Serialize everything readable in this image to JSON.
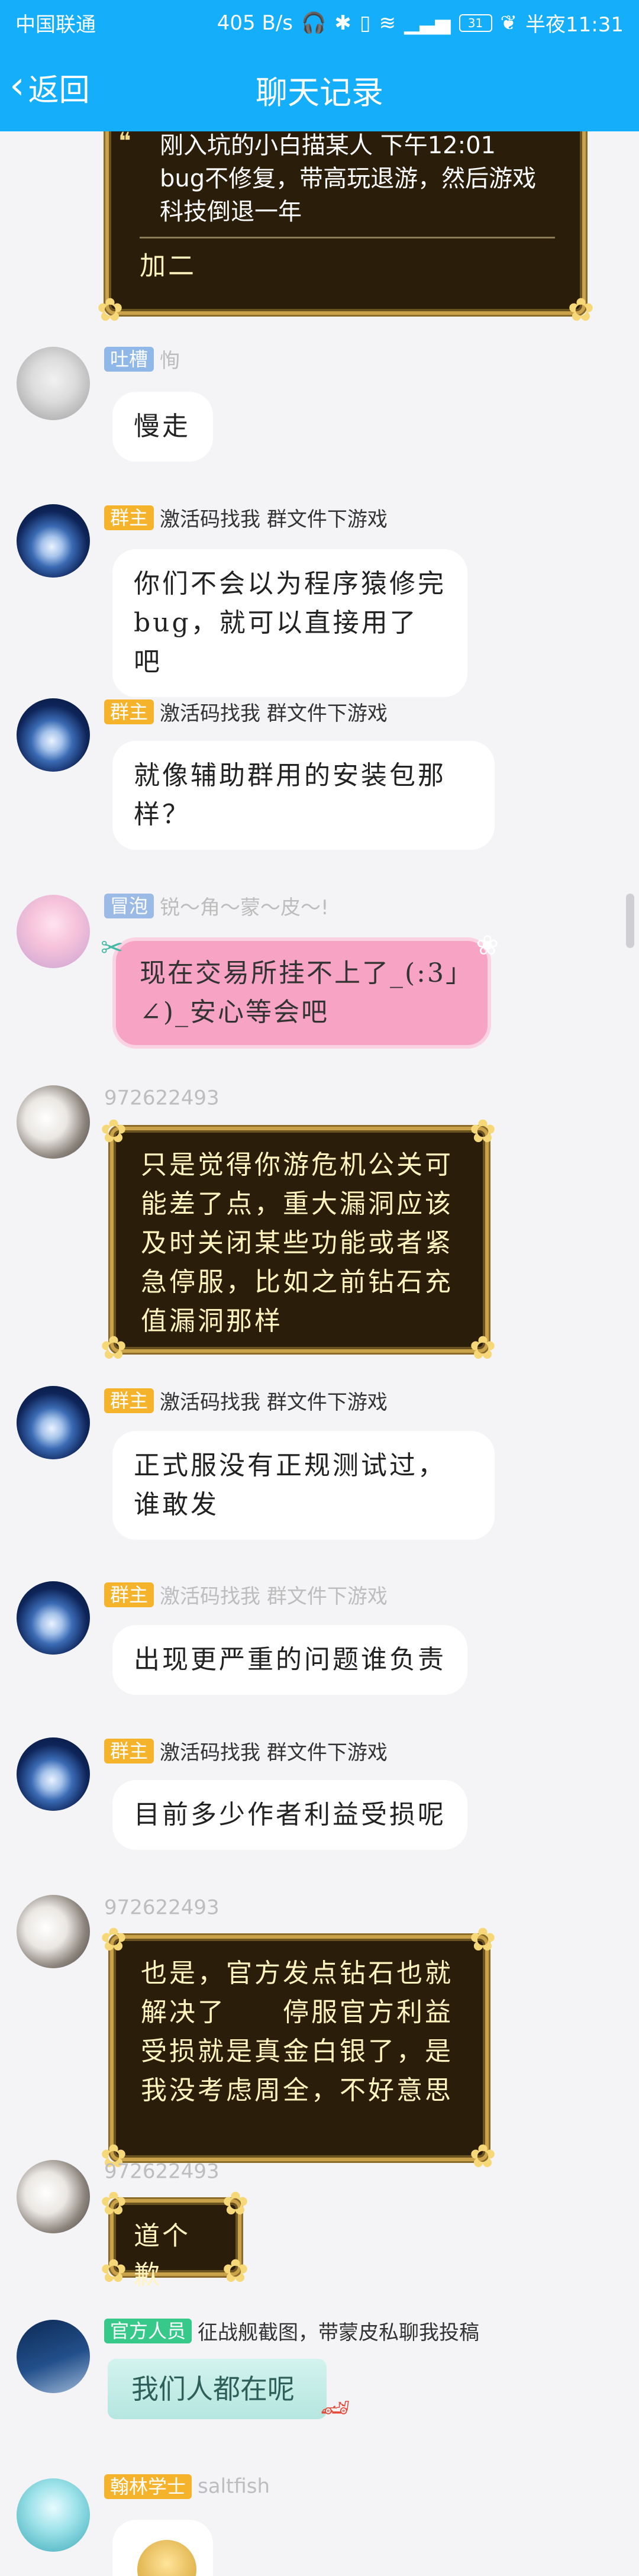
{
  "status": {
    "carrier": "中国联通",
    "speed": "405 B/s",
    "battery": "31",
    "time": "半夜11:31"
  },
  "header": {
    "back_label": "返回",
    "title": "聊天记录"
  },
  "messages": [
    {
      "quoted": "刚入坑的小白描某人 下午12:01",
      "body": "bug不修复，带高玩退游，然后游戏科技倒退一年",
      "reply": "加二"
    },
    {
      "badge": "吐槽",
      "name": "恂",
      "text": "慢走"
    },
    {
      "badge": "群主",
      "name": "激活码找我 群文件下游戏",
      "text": "你们不会以为程序猿修完bug，就可以直接用了吧"
    },
    {
      "badge": "群主",
      "name": "激活码找我 群文件下游戏",
      "text": "就像辅助群用的安装包那样？"
    },
    {
      "badge": "冒泡",
      "name": "锐～角～蒙～皮～!",
      "text": "现在交易所挂不上了_(:3」∠)_安心等会吧"
    },
    {
      "name": "972622493",
      "text": "只是觉得你游危机公关可能差了点，重大漏洞应该及时关闭某些功能或者紧急停服，比如之前钻石充值漏洞那样"
    },
    {
      "badge": "群主",
      "name": "激活码找我 群文件下游戏",
      "text": "正式服没有正规测试过，谁敢发"
    },
    {
      "badge": "群主",
      "name": "激活码找我 群文件下游戏",
      "text": "出现更严重的问题谁负责"
    },
    {
      "badge": "群主",
      "name": "激活码找我 群文件下游戏",
      "text": "目前多少作者利益受损呢"
    },
    {
      "name": "972622493",
      "text": "也是，官方发点钻石也就解决了　　停服官方利益受损就是真金白银了，是我没考虑周全，不好意思"
    },
    {
      "name": "972622493",
      "text": "道个歉"
    },
    {
      "badge": "官方人员",
      "name": "征战舰截图，带蒙皮私聊我投稿",
      "text": "我们人都在呢"
    },
    {
      "badge": "翰林学士",
      "name": "saltfish"
    }
  ],
  "colors": {
    "header_bg": "#15aefb",
    "badge_qunzhu": "#f5b32b",
    "badge_guanfang": "#36c98a",
    "badge_tucao": "#8fb7e8"
  }
}
